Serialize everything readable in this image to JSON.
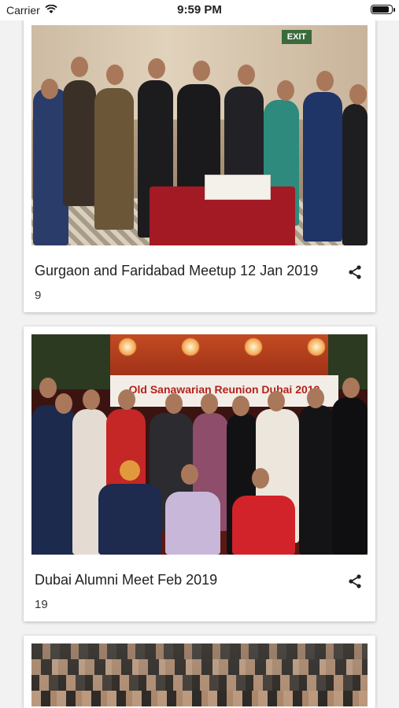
{
  "status_bar": {
    "carrier": "Carrier",
    "time": "9:59 PM",
    "battery_level": 0.92
  },
  "feed": {
    "cards": [
      {
        "title": "Gurgaon and Faridabad Meetup 12 Jan 2019",
        "count": "9",
        "share_icon": "share-icon",
        "photo": {
          "exit_sign": "EXIT"
        }
      },
      {
        "title": "Dubai Alumni Meet Feb 2019",
        "count": "19",
        "share_icon": "share-icon",
        "photo": {
          "banner": "Old Sanawarian Reunion Dubai 2019"
        }
      },
      {
        "title": "",
        "count": "",
        "share_icon": "share-icon"
      }
    ]
  },
  "colors": {
    "background": "#f2f2f2",
    "card": "#ffffff",
    "text": "#222222"
  }
}
